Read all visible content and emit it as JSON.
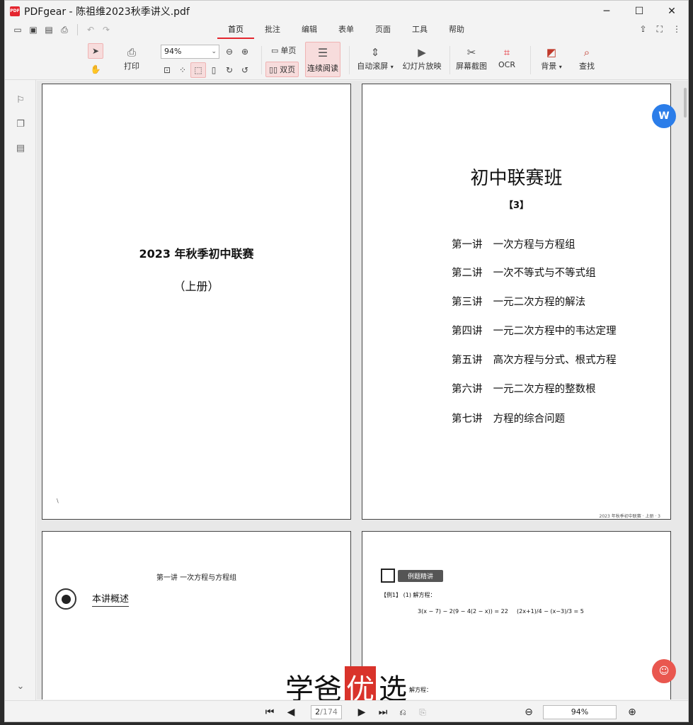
{
  "window": {
    "title": "PDFgear - 陈祖维2023秋季讲义.pdf",
    "logo_text": "PDF",
    "controls": {
      "minimize": "─",
      "maximize": "☐",
      "close": "✕"
    }
  },
  "menu": {
    "tabs": [
      {
        "label": "首页",
        "active": true
      },
      {
        "label": "批注"
      },
      {
        "label": "编辑"
      },
      {
        "label": "表单"
      },
      {
        "label": "页面"
      },
      {
        "label": "工具"
      },
      {
        "label": "帮助"
      }
    ]
  },
  "ribbon": {
    "print_label": "打印",
    "zoom_value": "94%",
    "single_page_label": "单页",
    "double_page_label": "双页",
    "continuous_label": "连续阅读",
    "auto_scroll_label": "自动滚屏",
    "slideshow_label": "幻灯片放映",
    "screenshot_label": "屏幕截图",
    "ocr_label": "OCR",
    "background_label": "背景",
    "find_label": "查找"
  },
  "pages": {
    "cover": {
      "title": "2023 年秋季初中联赛",
      "subtitle": "（上册）",
      "tiny_mark": "\\"
    },
    "toc": {
      "title": "初中联赛班",
      "number": "【3】",
      "items": [
        {
          "lecture": "第一讲",
          "topic": "一次方程与方程组"
        },
        {
          "lecture": "第二讲",
          "topic": "一次不等式与不等式组"
        },
        {
          "lecture": "第三讲",
          "topic": "一元二次方程的解法"
        },
        {
          "lecture": "第四讲",
          "topic": "一元二次方程中的韦达定理"
        },
        {
          "lecture": "第五讲",
          "topic": "高次方程与分式、根式方程"
        },
        {
          "lecture": "第六讲",
          "topic": "一元二次方程的整数根"
        },
        {
          "lecture": "第七讲",
          "topic": "方程的综合问题"
        }
      ],
      "footer": "2023 年秋季初中联赛 · 上册 · 3"
    },
    "lesson": {
      "header": "第一讲  一次方程与方程组",
      "overview_label": "本讲概述"
    },
    "examples": {
      "badge": "例题精讲",
      "ex1_label": "【例1】 (1) 解方程：",
      "eq_a": "3(x − 7) − 2(9 − 4(2 − x)) = 22",
      "eq_b": "(2x+1)/4 − (x−3)/3 = 5",
      "ex1_part2": "解方程："
    }
  },
  "watermark": {
    "left": "学爸",
    "mid": "优",
    "right": "选"
  },
  "status": {
    "current_page": "2",
    "total_pages": "/174",
    "zoom": "94%"
  },
  "colors": {
    "accent": "#e4262f",
    "fab_blue": "#2b7de9",
    "fab_red": "#e9574f"
  }
}
